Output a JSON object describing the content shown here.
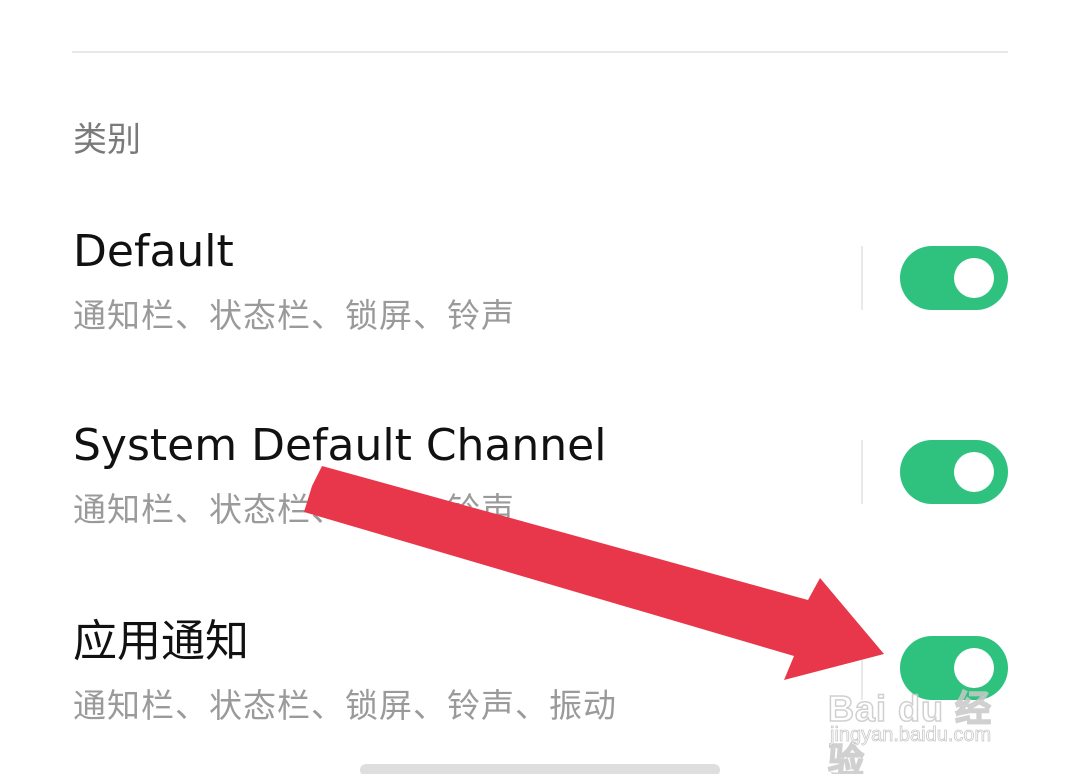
{
  "section": {
    "header": "类别"
  },
  "channels": [
    {
      "title": "Default",
      "subtitle": "通知栏、状态栏、锁屏、铃声",
      "enabled": true
    },
    {
      "title": "System Default Channel",
      "subtitle": "通知栏、状态栏、锁屏、铃声",
      "enabled": true
    },
    {
      "title": "应用通知",
      "subtitle": "通知栏、状态栏、锁屏、铃声、振动",
      "enabled": true
    }
  ],
  "annotation": {
    "arrow_color": "#e8374a",
    "points_to": "toggle-app-notifications"
  },
  "watermark": {
    "brand": "Bai du 经验",
    "url": "jingyan.baidu.com"
  },
  "colors": {
    "toggle_on": "#2ec27e",
    "title_text": "#111111",
    "subtitle_text": "#9a9a9a",
    "section_header_text": "#7a7a7a"
  }
}
